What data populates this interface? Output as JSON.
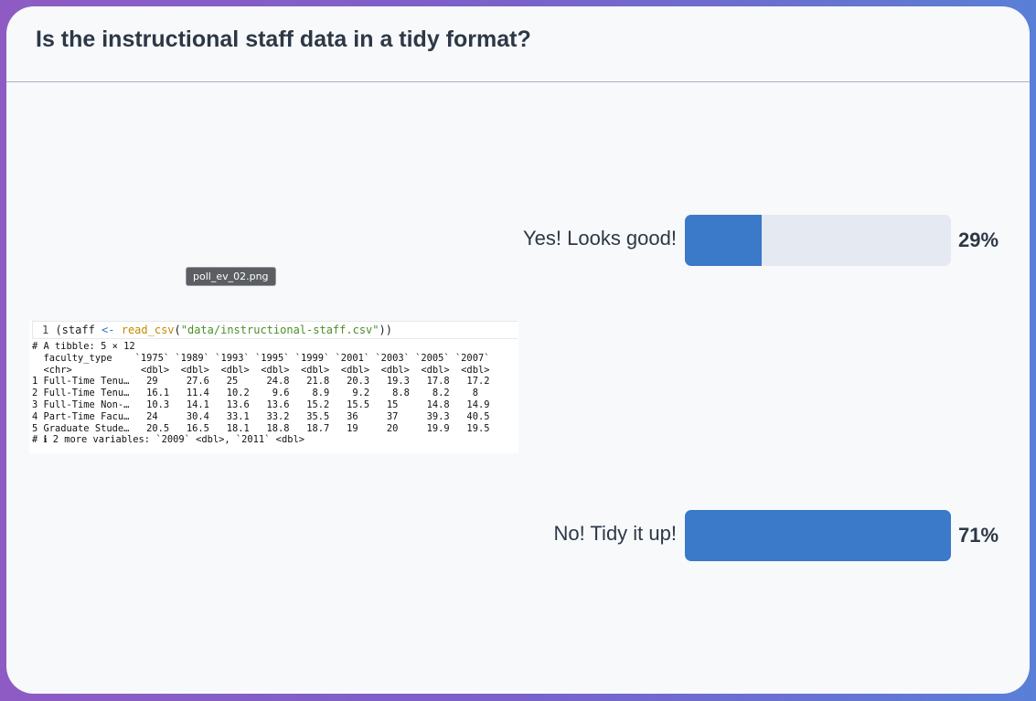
{
  "title": "Is the instructional staff data in a tidy format?",
  "image_tooltip": "poll_ev_02.png",
  "code": {
    "line_number": "1",
    "pre": " (staff ",
    "op": "<-",
    "space": " ",
    "fn": "read_csv",
    "open": "(",
    "str": "\"data/instructional-staff.csv\"",
    "close": "))"
  },
  "console_lines": [
    "# A tibble: 5 × 12",
    "  faculty_type    `1975` `1989` `1993` `1995` `1999` `2001` `2003` `2005` `2007`",
    "  <chr>            <dbl>  <dbl>  <dbl>  <dbl>  <dbl>  <dbl>  <dbl>  <dbl>  <dbl>",
    "1 Full-Time Tenu…   29     27.6   25     24.8   21.8   20.3   19.3   17.8   17.2",
    "2 Full-Time Tenu…   16.1   11.4   10.2    9.6    8.9    9.2    8.8    8.2    8  ",
    "3 Full-Time Non-…   10.3   14.1   13.6   13.6   15.2   15.5   15     14.8   14.9",
    "4 Part-Time Facu…   24     30.4   33.1   33.2   35.5   36     37     39.3   40.5",
    "5 Graduate Stude…   20.5   16.5   18.1   18.8   18.7   19     20     19.9   19.5",
    "# ℹ 2 more variables: `2009` <dbl>, `2011` <dbl>"
  ],
  "poll": {
    "options": [
      {
        "label": "Yes! Looks good!",
        "percent_label": "29%",
        "fraction": 0.29
      },
      {
        "label": "No! Tidy it up!",
        "percent_label": "71%",
        "fraction": 1.0
      }
    ]
  },
  "colors": {
    "bar_fill": "#3b79c9",
    "bar_track": "#e5e9f2",
    "text": "#2d3846"
  }
}
